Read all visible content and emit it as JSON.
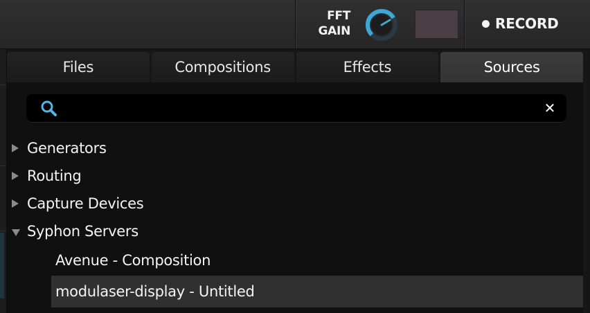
{
  "toolbar": {
    "fft_gain_line1": "FFT",
    "fft_gain_line2": "GAIN",
    "fft_gain_knob_value": 0.72,
    "knob_color": "#3fa7d6",
    "swatch_color": "#4a3d43",
    "record_label": "RECORD"
  },
  "tabs": [
    {
      "label": "Files",
      "active": false
    },
    {
      "label": "Compositions",
      "active": false
    },
    {
      "label": "Effects",
      "active": false
    },
    {
      "label": "Sources",
      "active": true
    }
  ],
  "search": {
    "value": "",
    "placeholder": "",
    "icon": "search-icon",
    "clear_icon": "close-icon"
  },
  "tree": {
    "groups": [
      {
        "label": "Generators",
        "expanded": false
      },
      {
        "label": "Routing",
        "expanded": false
      },
      {
        "label": "Capture Devices",
        "expanded": false
      },
      {
        "label": "Syphon Servers",
        "expanded": true
      }
    ],
    "syphon_children": [
      {
        "label": "Avenue - Composition",
        "selected": false
      },
      {
        "label": "modulaser-display - Untitled",
        "selected": true
      }
    ]
  },
  "colors": {
    "accent": "#3fa7d6",
    "tab_active": "#383838",
    "selection": "#303030"
  }
}
